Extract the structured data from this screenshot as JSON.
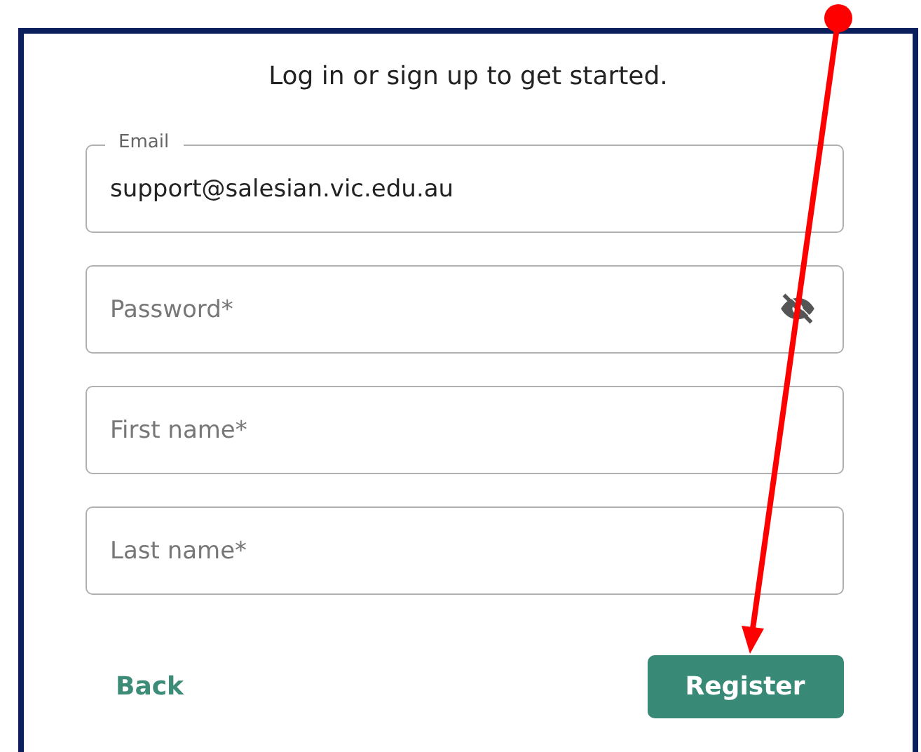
{
  "heading": "Log in or sign up to get started.",
  "fields": [
    {
      "kind": "email",
      "label": "Email",
      "value": "support@salesian.vic.edu.au"
    },
    {
      "kind": "password",
      "placeholder": "Password*"
    },
    {
      "kind": "text",
      "placeholder": "First name*"
    },
    {
      "kind": "text",
      "placeholder": "Last name*"
    }
  ],
  "buttons": [
    {
      "kind": "link",
      "label": "Back"
    },
    {
      "kind": "primary",
      "label": "Register"
    }
  ]
}
